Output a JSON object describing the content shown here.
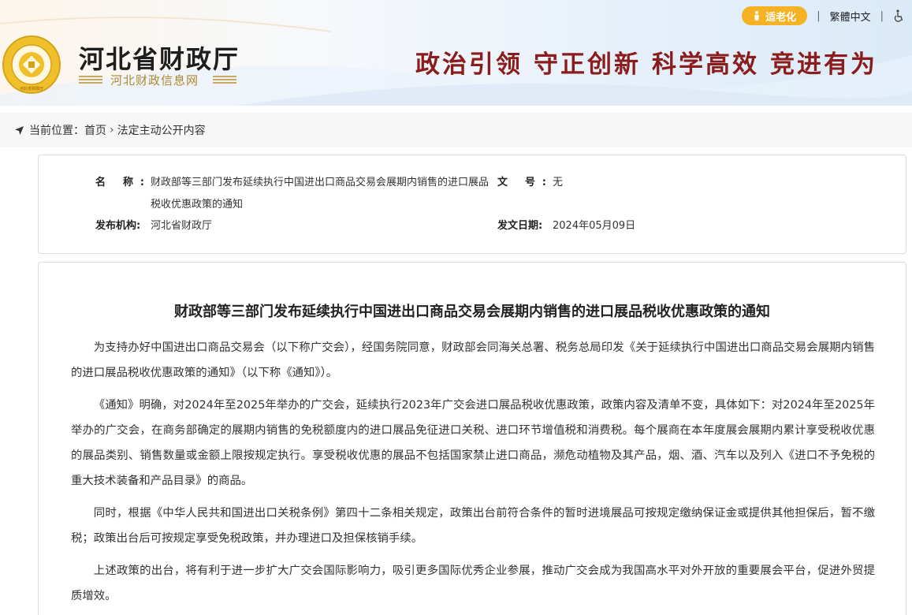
{
  "header": {
    "site_name": "河北省财政厅",
    "site_sub": "河北财政信息网",
    "emblem_text": "河北省财政厅",
    "slogans": [
      "政治引领",
      "守正创新",
      "科学高效",
      "竞进有为"
    ],
    "elder_mode": "适老化",
    "traditional": "繁體中文",
    "colors": {
      "slogan": "#8a1c1c",
      "elder_btn": "#f5b324",
      "gold": "#b0892f"
    }
  },
  "breadcrumb": {
    "label": "当前位置：",
    "home": "首页",
    "separator": "›",
    "current": "法定主动公开内容"
  },
  "meta": {
    "name_label": "名 称:",
    "name_value": "财政部等三部门发布延续执行中国进出口商品交易会展期内销售的进口展品税收优惠政策的通知",
    "docno_label": "文 号:",
    "docno_value": "无",
    "org_label": "发布机构:",
    "org_value": "河北省财政厅",
    "date_label": "发文日期:",
    "date_value": "2024年05月09日"
  },
  "article": {
    "title": "财政部等三部门发布延续执行中国进出口商品交易会展期内销售的进口展品税收优惠政策的通知",
    "paragraphs": [
      "为支持办好中国进出口商品交易会（以下称广交会），经国务院同意，财政部会同海关总署、税务总局印发《关于延续执行中国进出口商品交易会展期内销售的进口展品税收优惠政策的通知》（以下称《通知》）。",
      "《通知》明确，对2024年至2025年举办的广交会，延续执行2023年广交会进口展品税收优惠政策，政策内容及清单不变，具体如下：对2024年至2025年举办的广交会，在商务部确定的展期内销售的免税额度内的进口展品免征进口关税、进口环节增值税和消费税。每个展商在本年度展会展期内累计享受税收优惠的展品类别、销售数量或金额上限按规定执行。享受税收优惠的展品不包括国家禁止进口商品，濒危动植物及其产品，烟、酒、汽车以及列入《进口不予免税的重大技术装备和产品目录》的商品。",
      "同时，根据《中华人民共和国进出口关税条例》第四十二条相关规定，政策出台前符合条件的暂时进境展品可按规定缴纳保证金或提供其他担保后，暂不缴税；政策出台后可按规定享受免税政策，并办理进口及担保核销手续。",
      "上述政策的出台，将有利于进一步扩大广交会国际影响力，吸引更多国际优秀企业参展，推动广交会成为我国高水平对外开放的重要展会平台，促进外贸提质增效。"
    ]
  }
}
